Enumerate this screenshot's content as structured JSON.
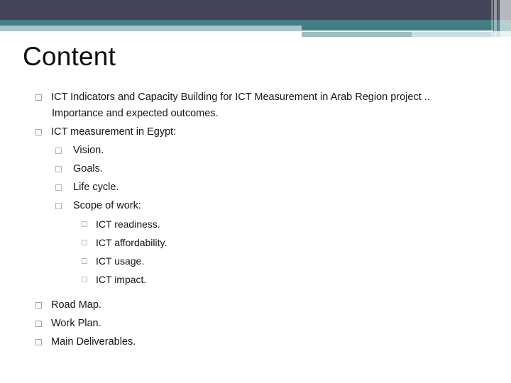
{
  "slide": {
    "title": "Content"
  },
  "theme": {
    "navy": "#424457",
    "teal": "#437d84",
    "pale_blue": "#a9c3c7",
    "light_wash": "#cddee0",
    "marker_outline": "#8fa8b5",
    "text": "#141414"
  },
  "content": {
    "items": [
      {
        "level": 1,
        "marker": "hollow-square-bullet",
        "text": "ICT Indicators and Capacity Building for ICT Measurement in Arab Region project .."
      },
      {
        "level": 1,
        "continuation": true,
        "text": "Importance and expected outcomes."
      },
      {
        "level": 1,
        "marker": "hollow-square-bullet",
        "text": "ICT measurement in Egypt:"
      },
      {
        "level": 2,
        "marker": "hollow-square-bullet",
        "text": "Vision."
      },
      {
        "level": 2,
        "marker": "hollow-square-bullet",
        "text": "Goals."
      },
      {
        "level": 2,
        "marker": "hollow-square-bullet",
        "text": "Life cycle."
      },
      {
        "level": 2,
        "marker": "hollow-square-bullet",
        "text": "Scope of work:"
      },
      {
        "level": 3,
        "marker": "hollow-square-bullet",
        "text": "ICT readiness."
      },
      {
        "level": 3,
        "marker": "hollow-square-bullet",
        "text": "ICT affordability."
      },
      {
        "level": 3,
        "marker": "hollow-square-bullet",
        "text": "ICT usage."
      },
      {
        "level": 3,
        "marker": "hollow-square-bullet",
        "text": "ICT impact."
      },
      {
        "level": 1,
        "marker": "hollow-square-bullet",
        "text": "Road Map."
      },
      {
        "level": 1,
        "marker": "hollow-square-bullet",
        "text": "Work Plan."
      },
      {
        "level": 1,
        "marker": "hollow-square-bullet",
        "text": "Main Deliverables."
      }
    ]
  }
}
